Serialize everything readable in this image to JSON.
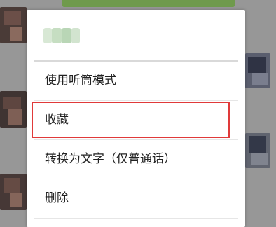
{
  "context_menu": {
    "header_name": "",
    "items": [
      {
        "label": "使用听筒模式"
      },
      {
        "label": "收藏"
      },
      {
        "label": "转换为文字（仅普通话）"
      },
      {
        "label": "删除"
      }
    ],
    "highlighted_item": "收藏"
  },
  "colors": {
    "dim_background": "#979797",
    "bubble_green": "#6f9a4c",
    "menu_background": "#ffffff",
    "divider": "#e6e6e6",
    "highlight_border": "#e03a3a",
    "text": "#222222"
  },
  "icons": {
    "avatar_left": "blurred-avatar-icon",
    "avatar_right": "blurred-avatar-icon"
  }
}
